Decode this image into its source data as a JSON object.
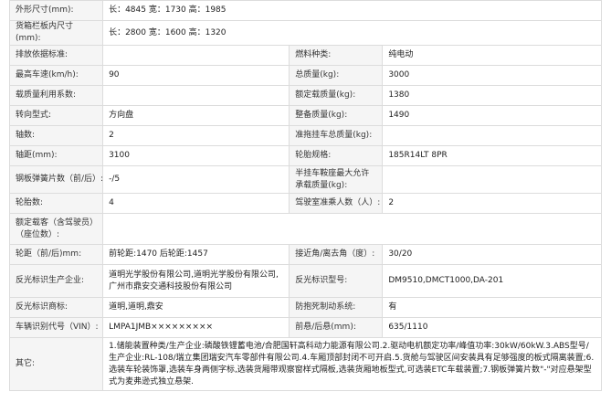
{
  "rows": [
    {
      "type": "full",
      "label": "外形尺寸(mm):",
      "value": "长：4845 宽：1730 高：1985"
    },
    {
      "type": "full",
      "label": "货箱栏板内尺寸(mm):",
      "value": "长：2800 宽：1600 高：1320"
    },
    {
      "type": "pair",
      "l1": "排放依据标准:",
      "v1": "",
      "l2": "燃料种类:",
      "v2": "纯电动"
    },
    {
      "type": "pair",
      "l1": "最高车速(km/h):",
      "v1": "90",
      "l2": "总质量(kg):",
      "v2": "3000"
    },
    {
      "type": "pair",
      "l1": "载质量利用系数:",
      "v1": "",
      "l2": "额定载质量(kg):",
      "v2": "1380"
    },
    {
      "type": "pair",
      "l1": "转向型式:",
      "v1": "方向盘",
      "l2": "整备质量(kg):",
      "v2": "1490"
    },
    {
      "type": "pair",
      "l1": "轴数:",
      "v1": "2",
      "l2": "准拖挂车总质量(kg):",
      "v2": ""
    },
    {
      "type": "pair",
      "l1": "轴距(mm):",
      "v1": "3100",
      "l2": "轮胎规格:",
      "v2": "185R14LT 8PR"
    },
    {
      "type": "pair",
      "l1": "钢板弹簧片数（前/后）:",
      "v1": "-/5",
      "l2": "半挂车鞍座最大允许承载质量(kg):",
      "v2": ""
    },
    {
      "type": "pair",
      "l1": "轮胎数:",
      "v1": "4",
      "l2": "驾驶室准乘人数（人）:",
      "v2": "2"
    },
    {
      "type": "full",
      "label": "额定载客（含驾驶员）（座位数）:",
      "value": ""
    },
    {
      "type": "pair",
      "l1": "轮距（前/后)mm:",
      "v1": "前轮距:1470 后轮距:1457",
      "l2": "接近角/离去角（度）:",
      "v2": "30/20"
    },
    {
      "type": "pair",
      "l1": "反光标识生产企业:",
      "v1": "道明光学股份有限公司,道明光学股份有限公司,广州市鼎安交通科技股份有限公司",
      "l2": "反光标识型号:",
      "v2": "DM9510,DMCT1000,DA-201"
    },
    {
      "type": "pair",
      "l1": "反光标识商标:",
      "v1": "道明,道明,鼎安",
      "l2": "防抱死制动系统:",
      "v2": "有"
    },
    {
      "type": "pair",
      "l1": "车辆识别代号（VIN）:",
      "v1": "LMPA1JMB×××××××××",
      "l2": "前悬/后悬(mm):",
      "v2": "635/1110"
    },
    {
      "type": "full",
      "label": "其它:",
      "value": "1.储能装置种类/生产企业:磷酸铁锂蓄电池/合肥国轩高科动力能源有限公司.2.驱动电机额定功率/峰值功率:30kW/60kW.3.ABS型号/生产企业:RL-108/瑞立集团瑞安汽车零部件有限公司.4.车厢顶部封闭不可开启.5.货舱与驾驶区间安装具有足够强度的板式隔离装置;6.选装车轮装饰罩,选装车身两侧字标,选装货厢带观察窗样式隔板,选装货厢地板型式,可选装ETC车载装置;7.钢板弹簧片数\"-\"对应悬架型式为麦弗逊式独立悬架."
    }
  ]
}
